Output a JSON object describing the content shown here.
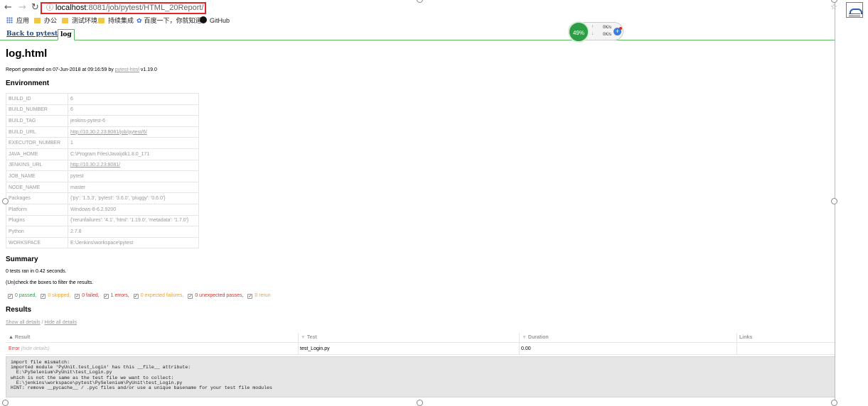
{
  "browser": {
    "address_host": "localhost",
    "address_path": ":8081/job/pytest/HTML_20Report/",
    "bookmarks": [
      "应用",
      "办公",
      "测试环境",
      "持续集成",
      "百度一下，你就知道",
      "GitHub"
    ]
  },
  "jenkins": {
    "back_link": "Back to pytest",
    "tab": "log"
  },
  "network_widget": {
    "cpu": "49%",
    "up": "0K/s",
    "down": "0K/s"
  },
  "report": {
    "title": "log.html",
    "generated_prefix": "Report generated on 07-Jun-2018 at 09:16:59 by ",
    "generated_link": "pytest-html",
    "generated_suffix": " v1.19.0",
    "environment_heading": "Environment",
    "environment": [
      {
        "key": "BUILD_ID",
        "value": "6"
      },
      {
        "key": "BUILD_NUMBER",
        "value": "6"
      },
      {
        "key": "BUILD_TAG",
        "value": "jenkins-pytest-6"
      },
      {
        "key": "BUILD_URL",
        "value": "http://10.30.2.23:8081/job/pytest/6/",
        "link": true
      },
      {
        "key": "EXECUTOR_NUMBER",
        "value": "1"
      },
      {
        "key": "JAVA_HOME",
        "value": "C:\\Program Files\\Java\\jdk1.8.0_171"
      },
      {
        "key": "JENKINS_URL",
        "value": "http://10.30.2.23:8081/",
        "link": true
      },
      {
        "key": "JOB_NAME",
        "value": "pytest"
      },
      {
        "key": "NODE_NAME",
        "value": "master"
      },
      {
        "key": "Packages",
        "value": "{'py': '1.5.3', 'pytest': '3.6.0', 'pluggy': '0.6.0'}"
      },
      {
        "key": "Platform",
        "value": "Windows-8-6.2.9200"
      },
      {
        "key": "Plugins",
        "value": "{'rerunfailures': '4.1', 'html': '1.19.0', 'metadata': '1.7.0'}"
      },
      {
        "key": "Python",
        "value": "2.7.8"
      },
      {
        "key": "WORKSPACE",
        "value": "E:\\Jenkins\\workspace\\pytest"
      }
    ],
    "summary_heading": "Summary",
    "summary_text": "0 tests ran in 0.42 seconds.",
    "filter_hint": "(Un)check the boxes to filter the results.",
    "filters": [
      "0 passed,",
      "0 skipped,",
      "0 failed,",
      "1 errors,",
      "0 expected failures,",
      "0 unexpected passes,",
      "0 rerun"
    ],
    "results_heading": "Results",
    "show_details": "Show all details",
    "details_sep": " / ",
    "hide_details": "Hide all details",
    "columns": {
      "result": "Result",
      "test": "Test",
      "duration": "Duration",
      "links": "Links"
    },
    "row": {
      "result": "Error",
      "hide": "(hide details)",
      "test": "test_Login.py",
      "duration": "0.00",
      "links": ""
    },
    "log_text": "import file mismatch:\nimported module 'PyUnit.test_Login' has this __file__ attribute:\n  E:\\PySelenium\\PyUnit\\test_Login.py\nwhich is not the same as the test file we want to collect:\n  E:\\jenkins\\workspace\\pytest\\PySelenium\\PyUnit\\test_Login.py\nHINT: remove __pycache__ / .pyc files and/or use a unique basename for your test file modules"
  }
}
